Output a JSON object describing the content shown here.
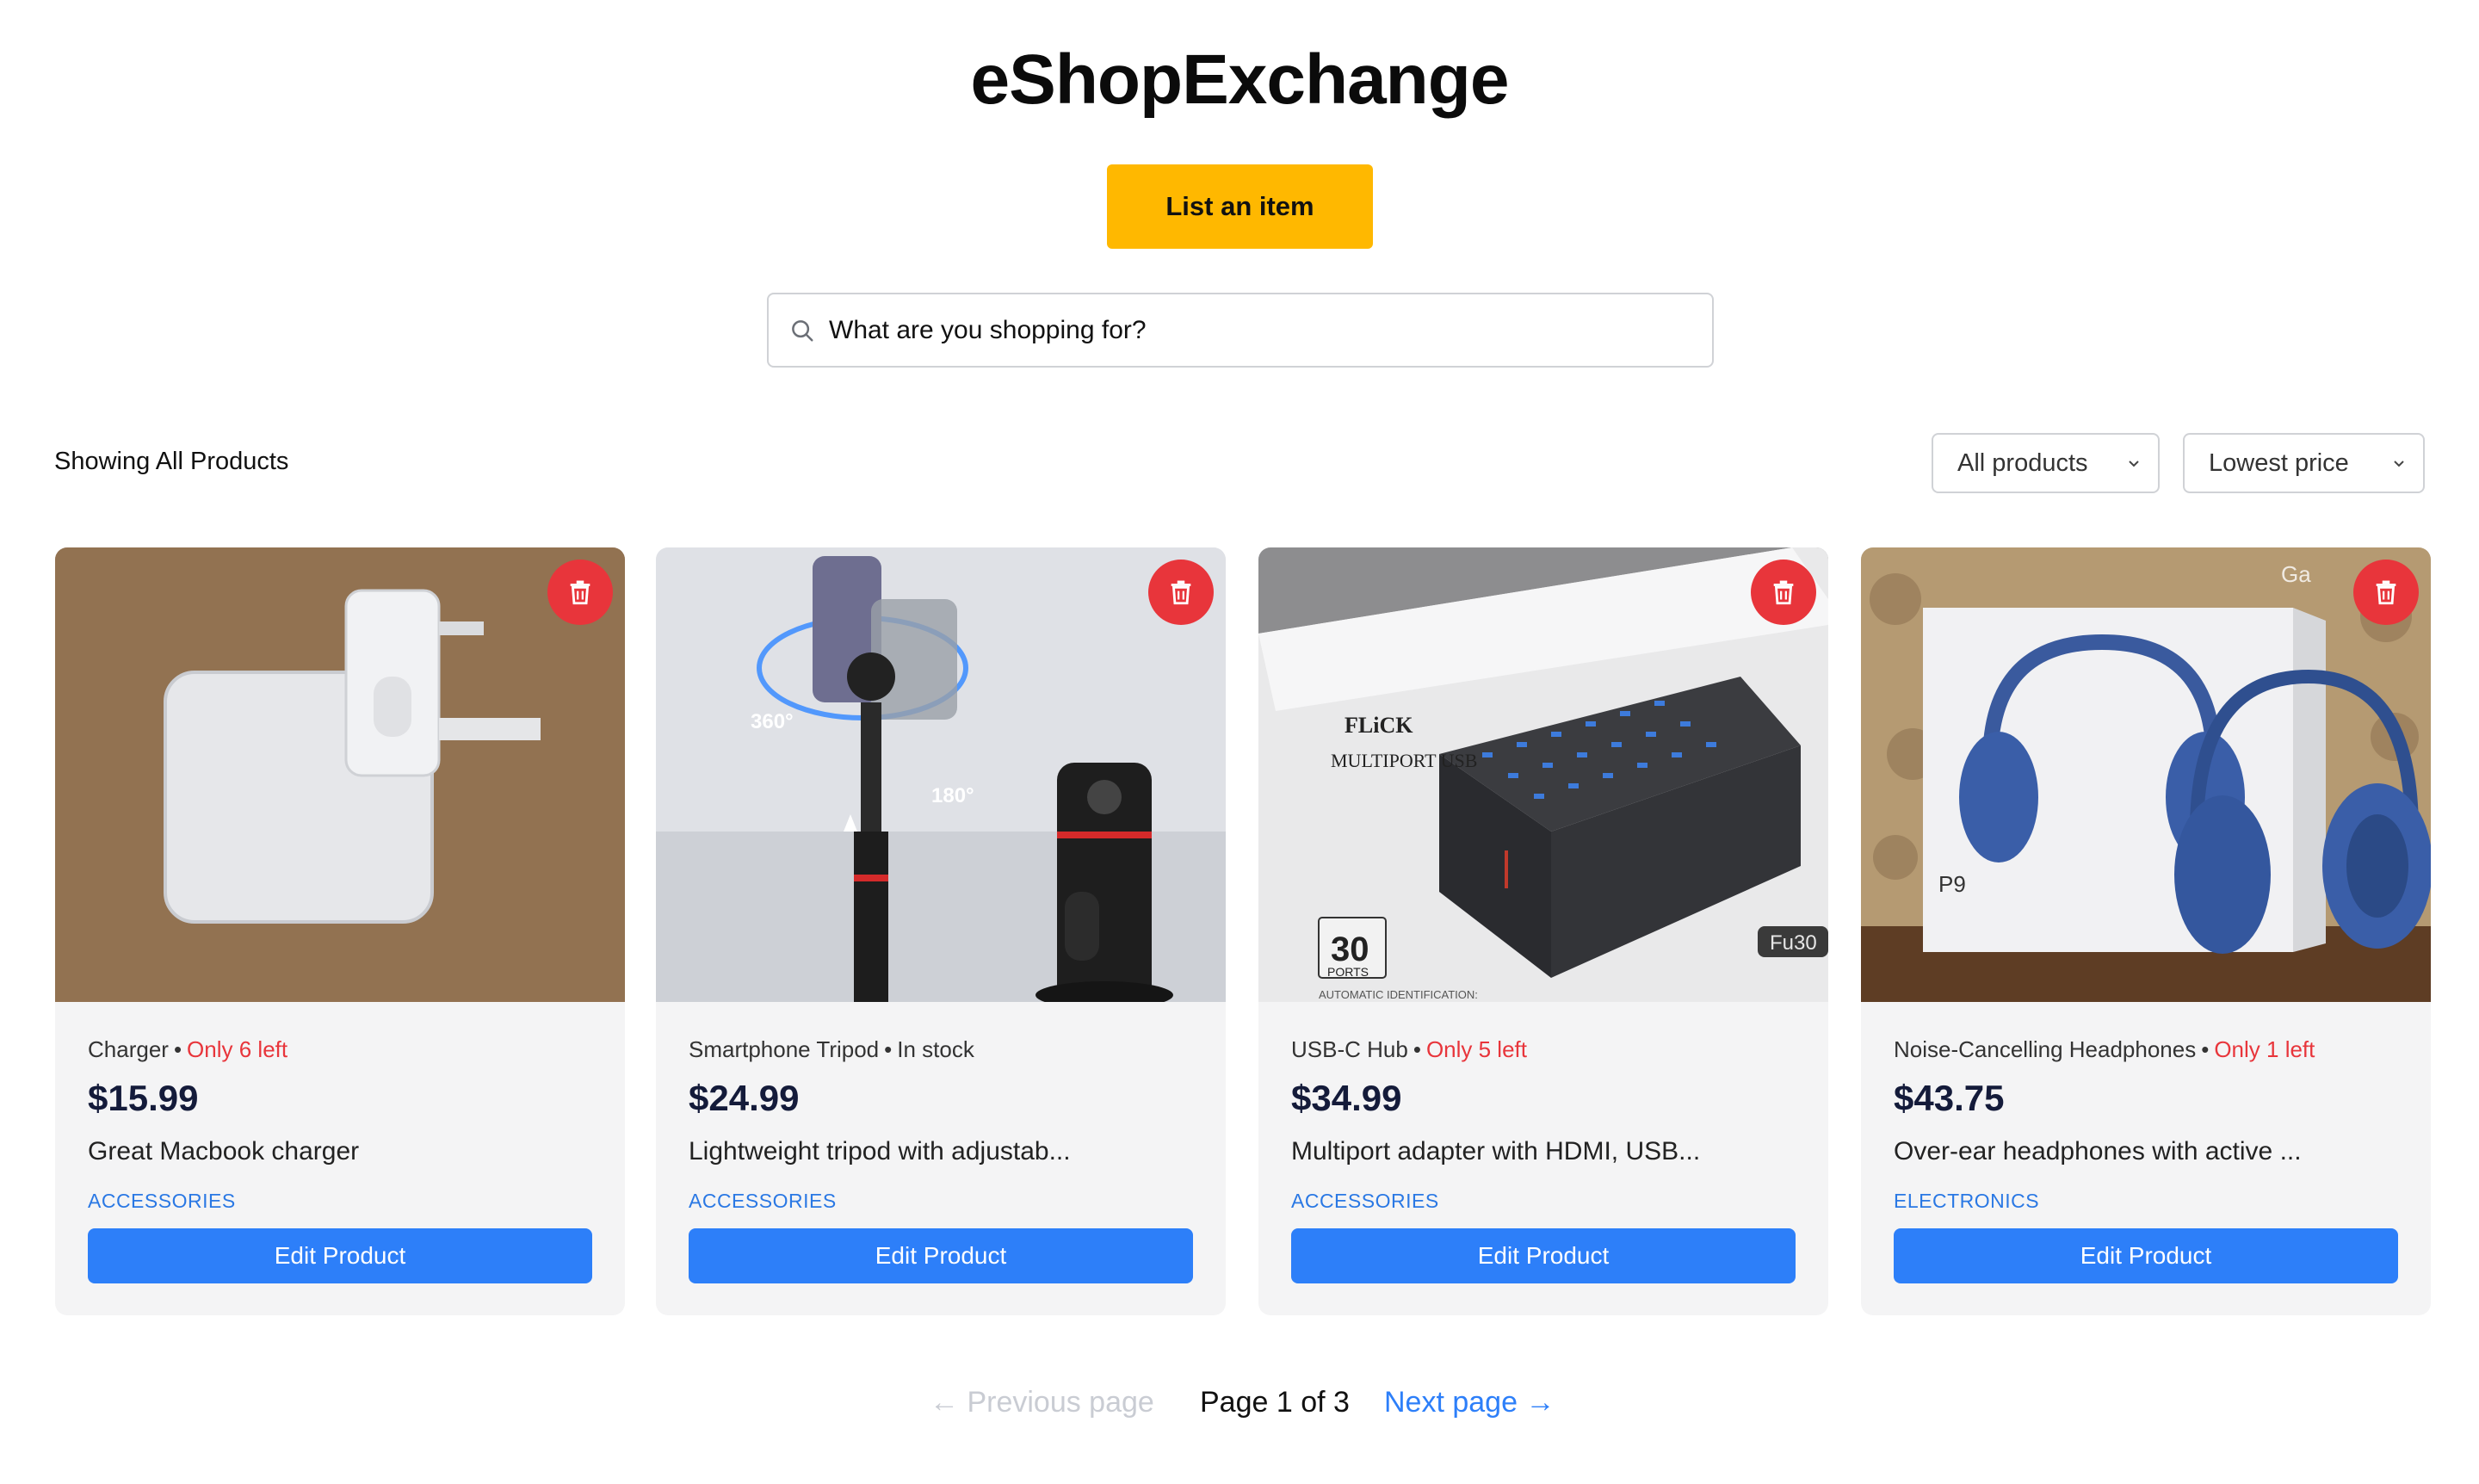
{
  "app": {
    "title": "eShopExchange"
  },
  "header": {
    "list_button": "List an item"
  },
  "search": {
    "placeholder": "What are you shopping for?",
    "icon": "search-icon"
  },
  "toolbar": {
    "showing_label": "Showing All Products",
    "filter": {
      "selected": "All products"
    },
    "sort": {
      "selected": "Lowest price"
    }
  },
  "products": [
    {
      "name": "Charger",
      "separator": "•",
      "stock": "Only 6 left",
      "stock_low": true,
      "price": "$15.99",
      "description": "Great Macbook charger",
      "category": "ACCESSORIES",
      "edit_label": "Edit Product"
    },
    {
      "name": "Smartphone Tripod",
      "separator": "•",
      "stock": "In stock",
      "stock_low": false,
      "price": "$24.99",
      "description": "Lightweight tripod with adjustab...",
      "category": "ACCESSORIES",
      "edit_label": "Edit Product",
      "image_text": {
        "deg360": "360°",
        "deg180": "180°"
      }
    },
    {
      "name": "USB-C Hub",
      "separator": "•",
      "stock": "Only 5 left",
      "stock_low": true,
      "price": "$34.99",
      "description": "Multiport adapter with HDMI, USB...",
      "category": "ACCESSORIES",
      "edit_label": "Edit Product",
      "image_text": {
        "brand": "FLiCK",
        "line": "MULTIPORT USB",
        "ports_num": "30",
        "ports_word": "PORTS",
        "model": "Fu30",
        "id_text": "AUTOMATIC IDENTIFICATION:"
      }
    },
    {
      "name": "Noise-Cancelling Headphones",
      "separator": "•",
      "stock": "Only 1 left",
      "stock_low": true,
      "price": "$43.75",
      "description": "Over-ear headphones with active ...",
      "category": "ELECTRONICS",
      "edit_label": "Edit Product",
      "image_text": {
        "model": "P9",
        "corner": "Ga"
      }
    }
  ],
  "pagination": {
    "prev_label": "← Previous page",
    "page_info": "Page 1 of 3",
    "next_label": "Next page →"
  },
  "colors": {
    "accent": "#ffb800",
    "primary": "#2d7ff9",
    "danger": "#e8353b",
    "category": "#2a78e4"
  }
}
